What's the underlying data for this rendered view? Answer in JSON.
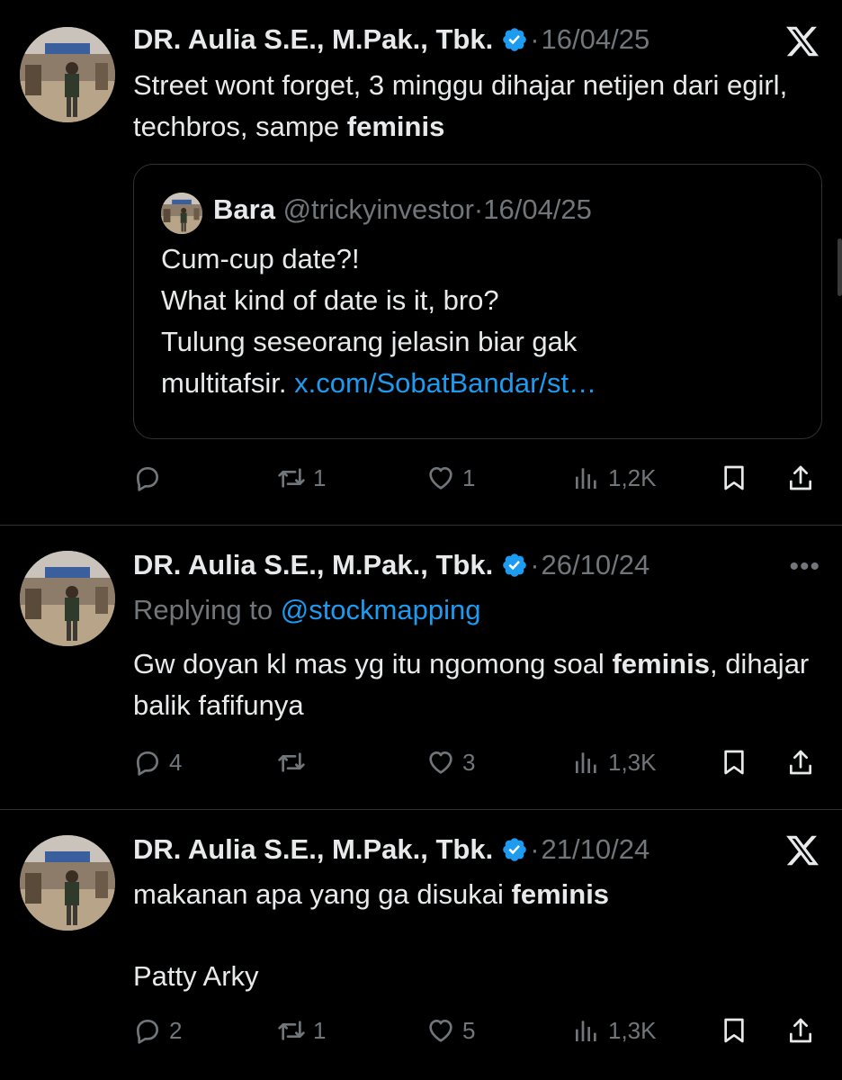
{
  "tweets": [
    {
      "author": "DR. Aulia S.E., M.Pak., Tbk.",
      "separator": "·",
      "date": "16/04/25",
      "text_before": "Street wont forget, 3 minggu dihajar netijen dari egirl, techbros, sampe ",
      "text_bold": "feminis",
      "quote": {
        "name": "Bara",
        "handle": "@trickyinvestor",
        "separator": "·",
        "date": "16/04/25",
        "lines": [
          "Cum-cup date?!",
          "What kind of date is it, bro?",
          "Tulung seseorang jelasin biar gak"
        ],
        "last_line_text": "multitafsir. ",
        "link": "x.com/SobatBandar/st…"
      },
      "replies": "",
      "reposts": "1",
      "likes": "1",
      "views": "1,2K"
    },
    {
      "author": "DR. Aulia S.E., M.Pak., Tbk.",
      "separator": "·",
      "date": "26/10/24",
      "more_label": "•••",
      "replying_prefix": "Replying to ",
      "replying_handle": "@stockmapping",
      "text_before": "Gw doyan kl mas yg itu ngomong soal ",
      "text_bold": "feminis",
      "text_after": ", dihajar balik fafifunya",
      "replies": "4",
      "reposts": "",
      "likes": "3",
      "views": "1,3K"
    },
    {
      "author": "DR. Aulia S.E., M.Pak., Tbk.",
      "separator": "·",
      "date": "21/10/24",
      "text_before": "makanan apa yang ga disukai ",
      "text_bold": "feminis",
      "text_second": "Patty Arky",
      "replies": "2",
      "reposts": "1",
      "likes": "5",
      "views": "1,3K"
    }
  ],
  "icons": {
    "verified": "verified-badge-icon",
    "x_logo": "x-logo-icon",
    "reply": "reply-icon",
    "repost": "repost-icon",
    "like": "heart-icon",
    "views": "views-icon",
    "bookmark": "bookmark-icon",
    "share": "share-icon"
  },
  "colors": {
    "background": "#000000",
    "text": "#e7e9ea",
    "muted": "#71767b",
    "link": "#1d9bf0",
    "divider": "#2f3336"
  }
}
